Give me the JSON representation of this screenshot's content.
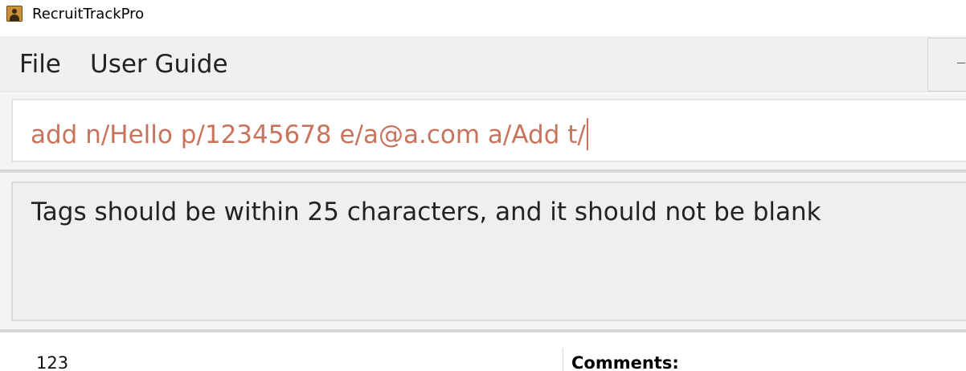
{
  "window": {
    "title": "RecruitTrackPro",
    "icon": "person-icon"
  },
  "menu": {
    "items": [
      {
        "label": "File"
      },
      {
        "label": "User Guide"
      }
    ]
  },
  "command_box": {
    "value": "add n/Hello p/12345678 e/a@a.com a/Add t/",
    "text_color": "#c8735c"
  },
  "result_display": {
    "message": "Tags should be within 25 characters, and it should not be blank"
  },
  "details": {
    "list_value": "123",
    "comments_label": "Comments:"
  }
}
